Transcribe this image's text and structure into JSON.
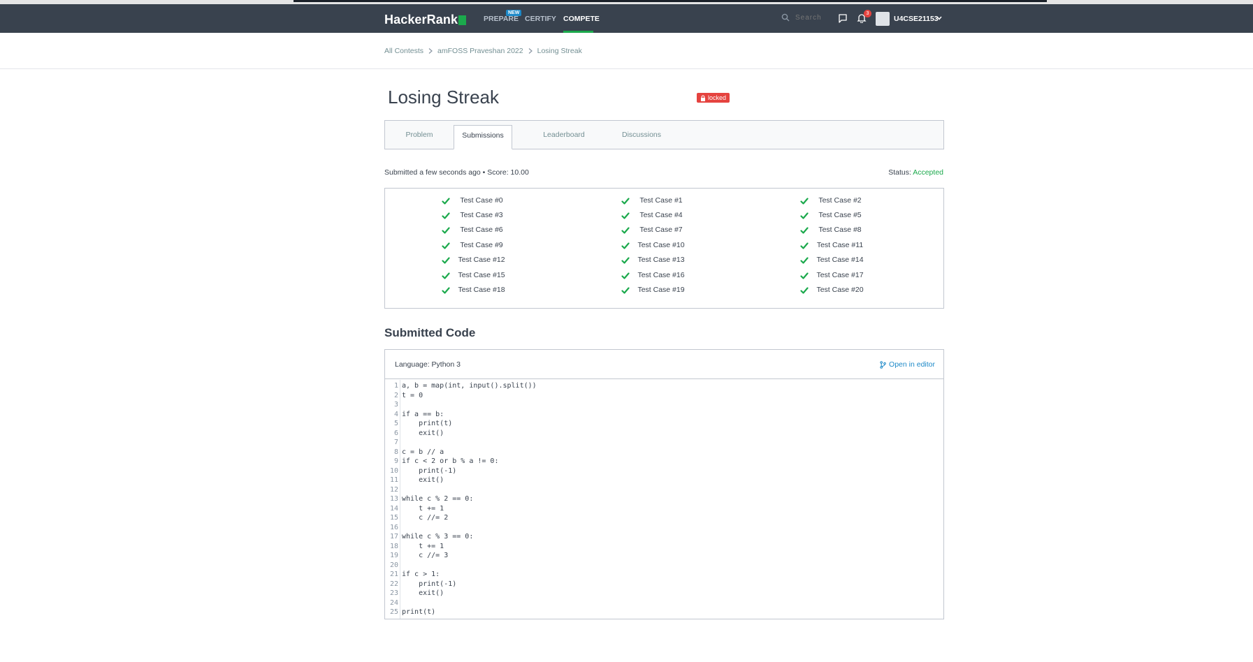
{
  "nav": {
    "logo_text": "HackerRank",
    "links": [
      {
        "label": "PREPARE"
      },
      {
        "label": "CERTIFY"
      },
      {
        "label": "COMPETE"
      }
    ],
    "new_badge": "NEW",
    "search_placeholder": "Search",
    "notification_count": "3",
    "username": "U4CSE21153",
    "accent_color": "#1ba94c",
    "bar_color": "#39424e"
  },
  "breadcrumb": {
    "items": [
      "All Contests",
      "amFOSS Praveshan 2022",
      "Losing Streak"
    ]
  },
  "challenge": {
    "title": "Losing Streak",
    "locked_label": "locked"
  },
  "tabs": [
    {
      "label": "Problem"
    },
    {
      "label": "Submissions"
    },
    {
      "label": "Leaderboard"
    },
    {
      "label": "Discussions"
    }
  ],
  "submission": {
    "info": "Submitted a few seconds ago • Score: 10.00",
    "status_label": "Status:",
    "status_value": "Accepted",
    "status_color": "#1ba94c"
  },
  "test_cases": [
    "Test Case #0",
    "Test Case #1",
    "Test Case #2",
    "Test Case #3",
    "Test Case #4",
    "Test Case #5",
    "Test Case #6",
    "Test Case #7",
    "Test Case #8",
    "Test Case #9",
    "Test Case #10",
    "Test Case #11",
    "Test Case #12",
    "Test Case #13",
    "Test Case #14",
    "Test Case #15",
    "Test Case #16",
    "Test Case #17",
    "Test Case #18",
    "Test Case #19",
    "Test Case #20"
  ],
  "code": {
    "heading": "Submitted Code",
    "language": "Language: Python 3",
    "open_in_editor": "Open in editor",
    "lines": [
      "a, b = map(int, input().split())",
      "t = 0",
      "",
      "if a == b:",
      "    print(t)",
      "    exit()",
      "",
      "c = b // a",
      "if c < 2 or b % a != 0:",
      "    print(-1)",
      "    exit()",
      "",
      "while c % 2 == 0:",
      "    t += 1",
      "    c //= 2",
      "",
      "while c % 3 == 0:",
      "    t += 1",
      "    c //= 3",
      "",
      "if c > 1:",
      "    print(-1)",
      "    exit()",
      "",
      "print(t)"
    ]
  }
}
